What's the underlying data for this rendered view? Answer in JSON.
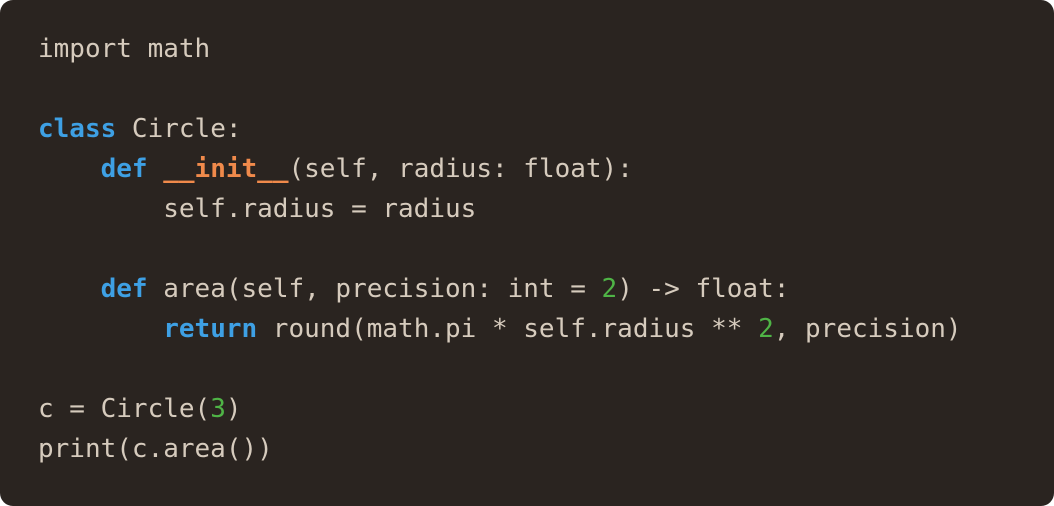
{
  "code": {
    "language": "python",
    "colors": {
      "background": "#2a2420",
      "text": "#d6cbbd",
      "keyword": "#3ea0e4",
      "function": "#f08a4b",
      "number": "#4fb446"
    },
    "lines": [
      {
        "tokens": [
          {
            "t": "plain",
            "v": "import math"
          }
        ]
      },
      {
        "tokens": []
      },
      {
        "tokens": [
          {
            "t": "kw",
            "v": "class"
          },
          {
            "t": "plain",
            "v": " Circle:"
          }
        ]
      },
      {
        "tokens": [
          {
            "t": "plain",
            "v": "    "
          },
          {
            "t": "kw",
            "v": "def"
          },
          {
            "t": "plain",
            "v": " "
          },
          {
            "t": "fn",
            "v": "__init__"
          },
          {
            "t": "plain",
            "v": "(self, radius: float):"
          }
        ]
      },
      {
        "tokens": [
          {
            "t": "plain",
            "v": "        self.radius = radius"
          }
        ]
      },
      {
        "tokens": []
      },
      {
        "tokens": [
          {
            "t": "plain",
            "v": "    "
          },
          {
            "t": "kw",
            "v": "def"
          },
          {
            "t": "plain",
            "v": " area(self, precision: int = "
          },
          {
            "t": "num",
            "v": "2"
          },
          {
            "t": "plain",
            "v": ") -> float:"
          }
        ]
      },
      {
        "tokens": [
          {
            "t": "plain",
            "v": "        "
          },
          {
            "t": "kw",
            "v": "return"
          },
          {
            "t": "plain",
            "v": " round(math.pi * self.radius ** "
          },
          {
            "t": "num",
            "v": "2"
          },
          {
            "t": "plain",
            "v": ", precision)"
          }
        ]
      },
      {
        "tokens": []
      },
      {
        "tokens": [
          {
            "t": "plain",
            "v": "c = Circle("
          },
          {
            "t": "num",
            "v": "3"
          },
          {
            "t": "plain",
            "v": ")"
          }
        ]
      },
      {
        "tokens": [
          {
            "t": "plain",
            "v": "print(c.area())"
          }
        ]
      }
    ]
  }
}
